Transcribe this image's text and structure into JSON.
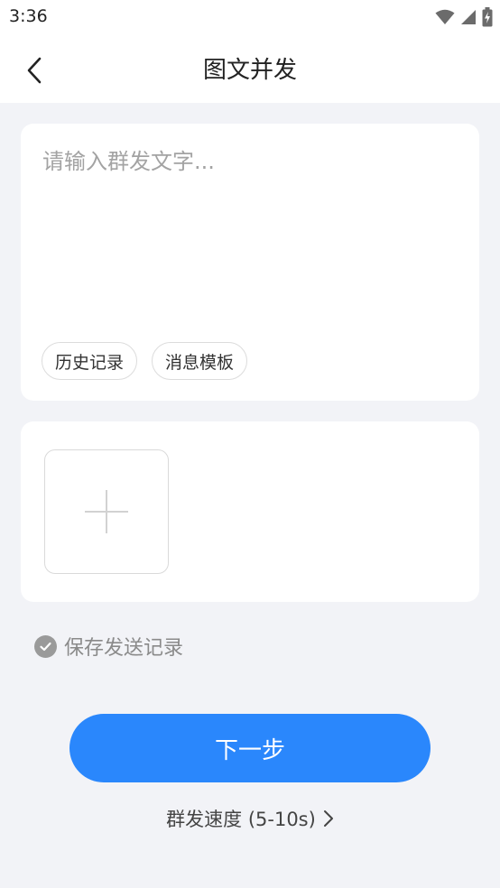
{
  "status_bar": {
    "time": "3:36",
    "icons": [
      "wifi-icon",
      "signal-icon",
      "battery-icon"
    ]
  },
  "nav": {
    "back_icon": "chevron-left-icon",
    "title": "图文并发"
  },
  "message": {
    "placeholder": "请输入群发文字...",
    "value": "",
    "chips": [
      {
        "label": "历史记录"
      },
      {
        "label": "消息模板"
      }
    ]
  },
  "images": {
    "add_icon": "plus-icon"
  },
  "save_record": {
    "checked": true,
    "label": "保存发送记录"
  },
  "actions": {
    "next_label": "下一步",
    "speed_label": "群发速度 (5-10s)"
  },
  "colors": {
    "primary": "#2a87fc",
    "background": "#f2f3f7",
    "card": "#ffffff"
  }
}
